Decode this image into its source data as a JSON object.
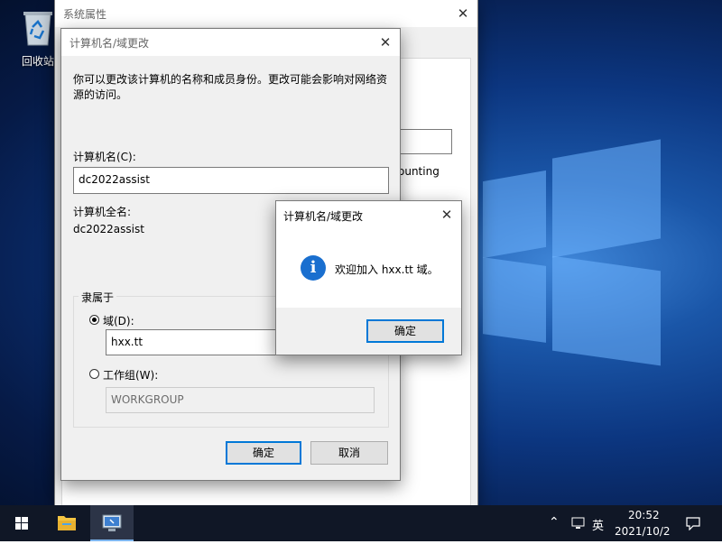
{
  "desktop": {
    "recycle_bin_label": "回收站"
  },
  "sys_props": {
    "title": "系统属性",
    "partial_text": "ounting"
  },
  "change_dialog": {
    "title": "计算机名/域更改",
    "description_line1": "你可以更改该计算机的名称和成员身份。更改可能会影响对网络资",
    "description_line2": "源的访问。",
    "computer_name_label": "计算机名(C):",
    "computer_name_value": "dc2022assist",
    "full_name_label": "计算机全名:",
    "full_name_value": "dc2022assist",
    "member_of_label": "隶属于",
    "domain_label": "域(D):",
    "domain_value": "hxx.tt",
    "workgroup_label": "工作组(W):",
    "workgroup_value": "WORKGROUP",
    "ok_label": "确定",
    "cancel_label": "取消"
  },
  "message_box": {
    "title": "计算机名/域更改",
    "icon_glyph": "i",
    "message": "欢迎加入 hxx.tt 域。",
    "ok_label": "确定"
  },
  "taskbar": {
    "ime": "英",
    "time": "20:52",
    "date": "2021/10/2"
  },
  "colors": {
    "accent": "#0078d7",
    "taskbar": "#101726"
  }
}
